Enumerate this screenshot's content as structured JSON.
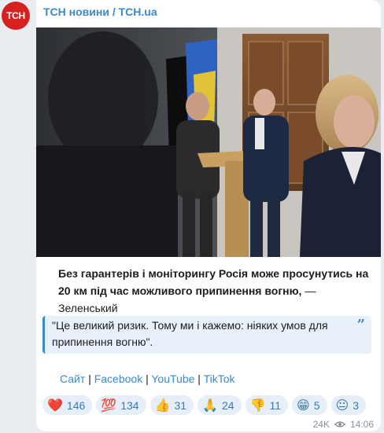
{
  "channel": {
    "avatar_text": "ТСН",
    "name": "ТСН новини / TCH.ua"
  },
  "post": {
    "caption_bold": "Без гарантерів і моніторингу Росія може просунутись на 20 км під час можливого припинення вогню,",
    "caption_rest": " — Зеленський",
    "quote_text": "\"Це великий ризик. Тому ми і кажемо: ніяких умов для припинення вогню\".",
    "links": [
      {
        "label": "Сайт"
      },
      {
        "label": "Facebook"
      },
      {
        "label": "YouTube"
      },
      {
        "label": "TikTok"
      }
    ],
    "reactions": [
      {
        "emoji": "❤️",
        "count": "146"
      },
      {
        "emoji": "💯",
        "count": "134"
      },
      {
        "emoji": "👍",
        "count": "31"
      },
      {
        "emoji": "🙏",
        "count": "24"
      },
      {
        "emoji": "👎",
        "count": "11"
      },
      {
        "emoji": "😁",
        "count": "5"
      },
      {
        "emoji": "😐",
        "count": "3"
      }
    ],
    "views": "24K",
    "time": "14:06"
  },
  "colors": {
    "accent": "#3a8ac7",
    "brand": "#d7211f"
  }
}
